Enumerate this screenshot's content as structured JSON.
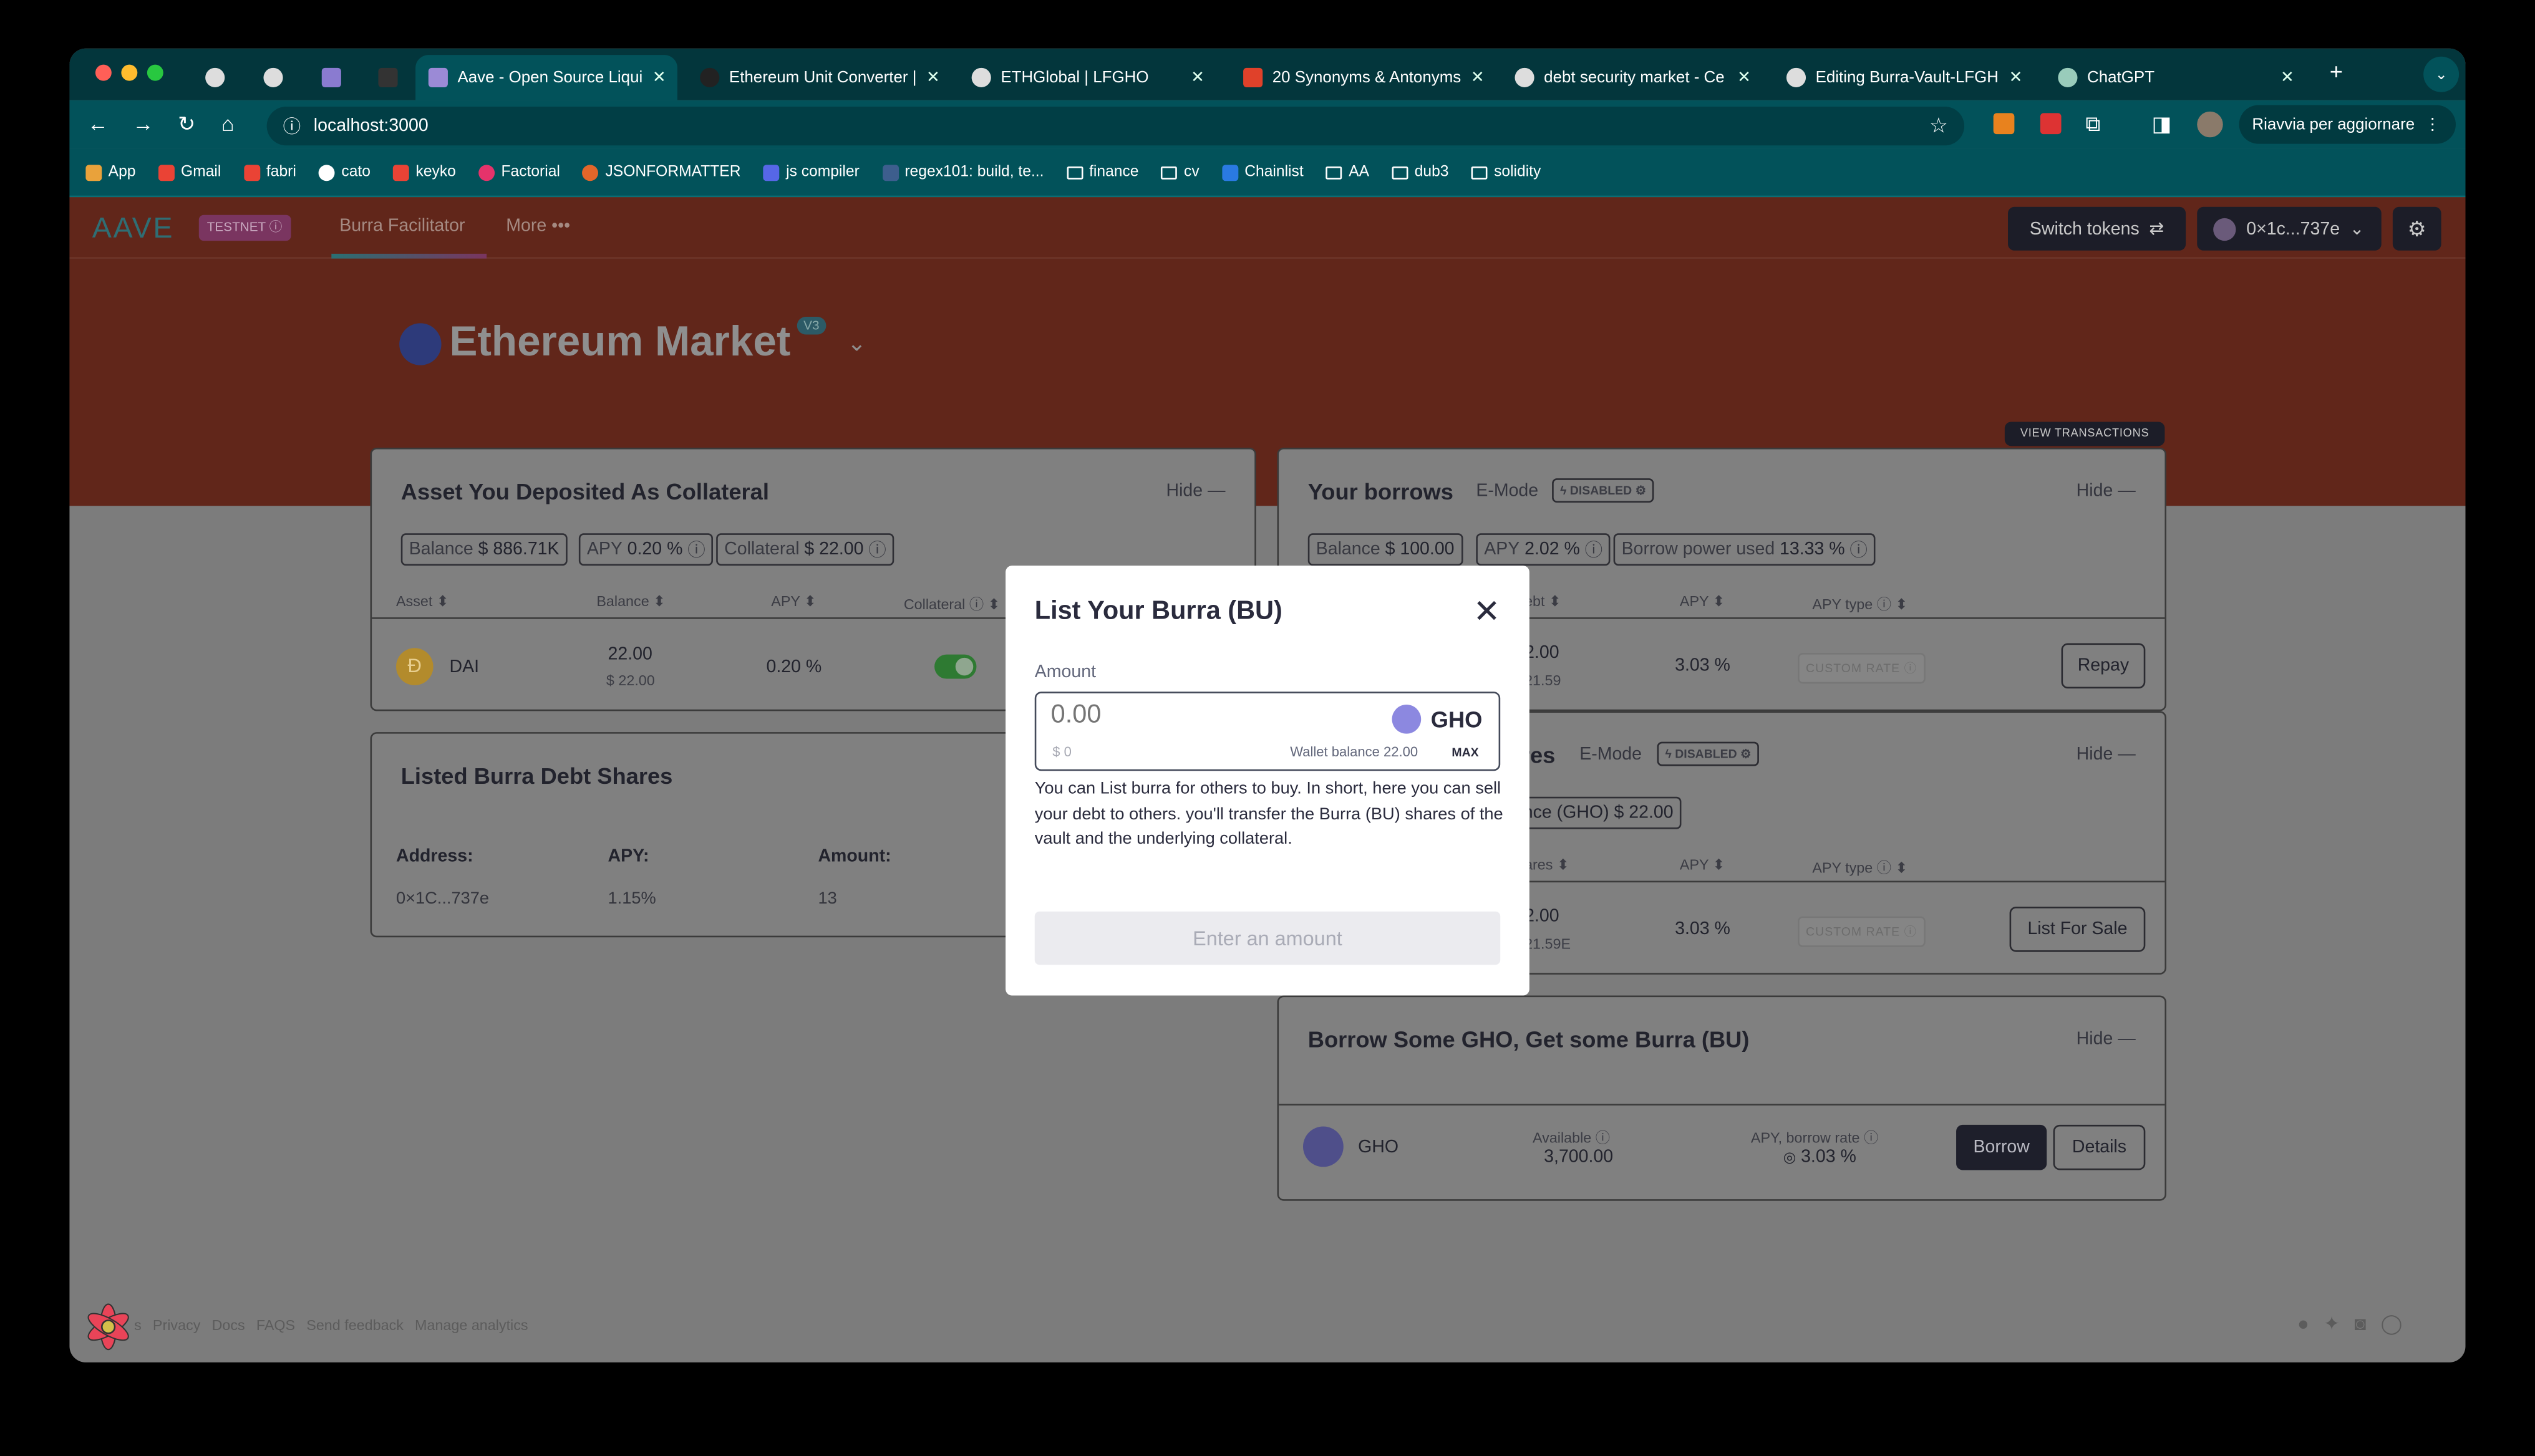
{
  "browser": {
    "tabs": [
      {
        "label": "",
        "icon": "github-icon"
      },
      {
        "label": "",
        "icon": "github-icon"
      },
      {
        "label": "",
        "icon": "app-icon"
      },
      {
        "label": "",
        "icon": "pen-icon"
      },
      {
        "label": "Aave - Open Source Liqui",
        "icon": "aave-icon",
        "active": true
      },
      {
        "label": "Ethereum Unit Converter |",
        "icon": "ethereum-icon"
      },
      {
        "label": "ETHGlobal | LFGHO",
        "icon": "ethglobal-icon"
      },
      {
        "label": "20 Synonyms & Antonyms",
        "icon": "thesaurus-icon"
      },
      {
        "label": "debt security market - Ce",
        "icon": "google-icon"
      },
      {
        "label": "Editing Burra-Vault-LFGH",
        "icon": "github-icon"
      },
      {
        "label": "ChatGPT",
        "icon": "chatgpt-icon"
      }
    ],
    "url": "localhost:3000",
    "relaunch_label": "Riavvia per aggiornare",
    "bookmarks": [
      "App",
      "Gmail",
      "fabri",
      "cato",
      "keyko",
      "Factorial",
      "JSONFORMATTER",
      "js compiler",
      "regex101: build, te...",
      "finance",
      "cv",
      "Chainlist",
      "AA",
      "dub3",
      "solidity"
    ],
    "colors": {
      "tabbar": "#03363c",
      "toolbar": "#02525a"
    }
  },
  "app": {
    "logo": "AAVE",
    "testnet_badge": "TESTNET",
    "nav": [
      "Burra Facilitator",
      "More •••"
    ],
    "switch_tokens": "Switch tokens",
    "wallet": "0×1c...737e",
    "market_title": "Ethereum Market",
    "market_version": "V3",
    "view_transactions": "VIEW TRANSACTIONS"
  },
  "collateral": {
    "title": "Asset You Deposited As Collateral",
    "hide": "Hide —",
    "pills": [
      {
        "label": "Balance",
        "value": "$ 886.71K"
      },
      {
        "label": "APY",
        "value": "0.20 %"
      },
      {
        "label": "Collateral",
        "value": "$ 22.00"
      }
    ],
    "headers": [
      "Asset",
      "Balance",
      "APY",
      "Collateral"
    ],
    "row": {
      "asset": "DAI",
      "balance": "22.00",
      "balance_usd": "$ 22.00",
      "apy": "0.20 %",
      "collateral_enabled": true
    }
  },
  "listed": {
    "title": "Listed Burra Debt Shares",
    "headers": [
      "Address:",
      "APY:",
      "Amount:"
    ],
    "row": {
      "address": "0×1C...737e",
      "apy": "1.15%",
      "amount": "13"
    }
  },
  "borrows": {
    "title": "Your borrows",
    "emode": "E-Mode",
    "emode_status": "DISABLED",
    "hide": "Hide —",
    "pills": [
      {
        "label": "Balance",
        "value": "$ 100.00"
      },
      {
        "label": "APY",
        "value": "2.02 %"
      },
      {
        "label": "Borrow power used",
        "value": "13.33 %"
      }
    ],
    "headers": [
      "ebt",
      "APY",
      "APY type"
    ],
    "row": {
      "debt": "2.00",
      "debt_usd": "21.59",
      "apy": "3.03 %",
      "apy_type": "CUSTOM RATE",
      "action": "Repay"
    }
  },
  "shares": {
    "title": "res",
    "emode": "E-Mode",
    "emode_status": "DISABLED",
    "hide": "Hide —",
    "pill": "ance (GHO) $ 22.00",
    "headers": [
      "ares",
      "APY",
      "APY type"
    ],
    "row": {
      "amount": "2.00",
      "amount_usd": "21.59E",
      "apy": "3.03 %",
      "apy_type": "CUSTOM RATE",
      "action": "List For Sale"
    }
  },
  "borrow_gho": {
    "title": "Borrow Some GHO, Get some Burra (BU)",
    "hide": "Hide —",
    "asset": "GHO",
    "available_label": "Available",
    "available": "3,700.00",
    "apy_label": "APY, borrow rate",
    "apy": "3.03 %",
    "borrow": "Borrow",
    "details": "Details"
  },
  "footer": {
    "links": [
      "s",
      "Privacy",
      "Docs",
      "FAQS",
      "Send feedback",
      "Manage analytics"
    ]
  },
  "modal": {
    "title": "List Your Burra (BU)",
    "amount_label": "Amount",
    "amount_placeholder": "0.00",
    "usd": "$ 0",
    "token": "GHO",
    "wallet_balance": "Wallet balance 22.00",
    "max": "MAX",
    "description": "You can List burra for others to buy. In short, here you can sell your debt to others. you'll transfer the Burra (BU) shares of the vault and the underlying collateral.",
    "submit": "Enter an amount"
  }
}
